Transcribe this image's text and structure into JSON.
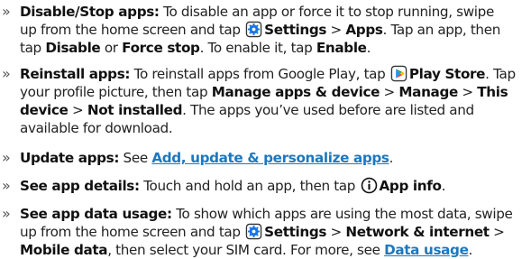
{
  "colors": {
    "link": "#1c78bf",
    "settings_icon": "#1a73e8",
    "text": "#222222"
  },
  "chevron": "»",
  "items": [
    {
      "lines": [
        [
          "Disable/Stop apps:",
          " To disable an app or force it to stop running, swipe"
        ],
        [
          "up from the home screen and tap ",
          "Settings",
          " > ",
          "Apps",
          ". Tap an app, then"
        ],
        [
          "tap ",
          "Disable",
          " or ",
          "Force stop",
          ". To enable it, tap ",
          "Enable",
          "."
        ]
      ]
    },
    {
      "lines": [
        [
          "Reinstall apps:",
          " To reinstall apps from Google Play, tap ",
          "Play Store",
          ". Tap"
        ],
        [
          "your profile picture, then tap ",
          "Manage apps & device",
          " > ",
          "Manage",
          " > ",
          "This"
        ],
        [
          "device",
          " > ",
          "Not installed",
          ". The apps you’ve used before are listed and"
        ],
        [
          "available for download."
        ]
      ]
    },
    {
      "lines": [
        [
          "Update apps:",
          " See ",
          "Add, update & personalize apps",
          "."
        ]
      ]
    },
    {
      "lines": [
        [
          "See app details:",
          " Touch and hold an app, then tap ",
          "App info",
          "."
        ]
      ]
    },
    {
      "lines": [
        [
          "See app data usage:",
          " To show which apps are using the most data, swipe"
        ],
        [
          "up from the home screen and tap ",
          "Settings",
          " > ",
          "Network & internet",
          " >"
        ],
        [
          "Mobile data",
          ", then select your SIM card. For more, see ",
          "Data usage",
          "."
        ]
      ]
    }
  ],
  "icons": {
    "settings": "settings-gear-icon",
    "play_store": "play-store-icon",
    "info": "info-icon"
  }
}
